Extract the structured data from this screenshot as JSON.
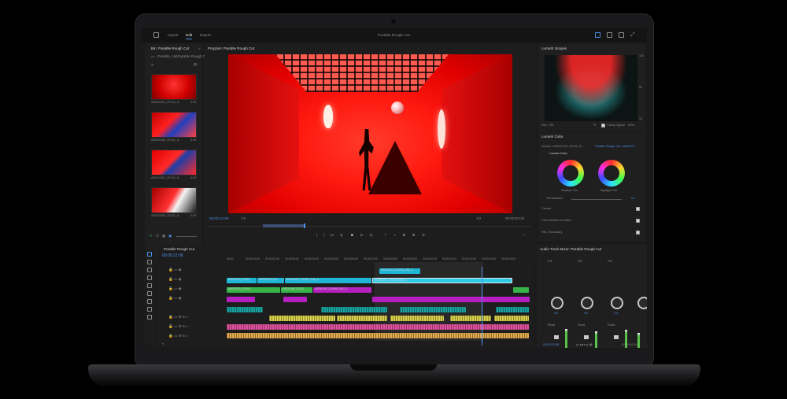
{
  "app": {
    "project_title": "Parable Rough Cut",
    "workspaces": [
      "Import",
      "Edit",
      "Export"
    ],
    "active_workspace": "Edit"
  },
  "bin": {
    "panel_title": "Bin: Parable Rough Cut",
    "path": "Parable_Hq\\Parable Rough Cut",
    "items": [
      {
        "name": "A003C010_22102_S...",
        "duration": "4:29"
      },
      {
        "name": "A003C009_22102_S...",
        "duration": "4:29"
      },
      {
        "name": "A002C007_22102_S...",
        "duration": "4:29"
      },
      {
        "name": "A003C009_22102_S...",
        "duration": "4:29"
      }
    ]
  },
  "program": {
    "panel_title": "Program: Parable Rough Cut",
    "timecode_current": "00:00:12:08",
    "fit": "Fit",
    "zoom": "1/2",
    "timecode_total": "00:00:03:10"
  },
  "scopes": {
    "panel_title": "Lumetri Scopes",
    "clamp_label": "Clamp Signal",
    "bit_label": "8 Bit",
    "rec_label": "Rec. 709",
    "scale": [
      "100",
      "90",
      "80",
      "70",
      "60",
      "50",
      "40",
      "30",
      "20",
      "10"
    ]
  },
  "lumetri": {
    "panel_title": "Lumetri Color",
    "source": "Source • A003C010_22102_S...",
    "target": "Parable Rough Cut • A003C0...",
    "section_title": "Lumetri Color",
    "shadow_label": "Shadow Tint",
    "highlight_label": "Highlight Tint",
    "tint_balance": "Tint Balance",
    "tint_value": "0.0",
    "sections": [
      "Curves",
      "Color Wheels & Match",
      "HSL Secondary"
    ]
  },
  "timeline": {
    "panel_title": "Parable Rough Cut",
    "timecode": "00:00:12:08",
    "ruler": [
      "00:00",
      "00:00:01:00",
      "00:00:02:00",
      "00:00:03:00",
      "00:00:04:00",
      "00:00:05:00",
      "00:00:06:00",
      "00:00:07:00",
      "00:00:08:00",
      "00:00:09:00",
      "00:00:10:00",
      "00:00:11:00",
      "00:00:12:00",
      "00:00:13:00",
      "00:00:14:00"
    ],
    "clip_labels": {
      "v3": "A003C003_220206_S1B_D...",
      "v2a": "A003C010_22102...",
      "v2b": "A003C009_222...",
      "v2c": "A003C003_220206_S1B_D...",
      "v2d": "A003C003_220206_S1B_D...",
      "v1a": "A003C009_22105...",
      "v1b": "A003C009_22102...",
      "v1c": "A003C003_220206_S1B_D..."
    }
  },
  "mixer": {
    "panel_title": "Audio Track Mixer: Parable Rough Cut",
    "channels": [
      "A1",
      "A2",
      "A3"
    ],
    "read_label": "Read",
    "value": "0.0",
    "timecode": "00:00:12:08",
    "timecode_end": "00:00:05:10"
  },
  "colors": {
    "accent": "#4d8fe8",
    "video_clip": "#1fb6d6",
    "magenta_clip": "#b51fbf",
    "green_clip": "#38b34a",
    "audio_teal": "#18a3a0",
    "audio_yellow": "#d8cf4a",
    "audio_pink": "#e0529d"
  }
}
